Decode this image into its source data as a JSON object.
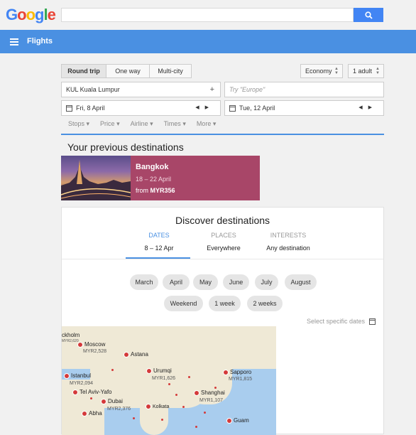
{
  "header": {
    "logo": "Google",
    "search_value": "",
    "section_title": "Flights"
  },
  "trip_type": {
    "options": [
      "Round trip",
      "One way",
      "Multi-city"
    ],
    "selected": "Round trip"
  },
  "cabin": "Economy",
  "passengers": "1 adult",
  "origin": "KUL Kuala Lumpur",
  "destination_placeholder": "Try \"Europe\"",
  "depart_date": "Fri, 8 April",
  "return_date": "Tue, 12 April",
  "filters": [
    "Stops",
    "Price",
    "Airline",
    "Times",
    "More"
  ],
  "previous": {
    "title": "Your previous destinations",
    "card": {
      "city": "Bangkok",
      "dates": "18 – 22 April",
      "price_prefix": "from",
      "price": "MYR356"
    }
  },
  "discover": {
    "title": "Discover destinations",
    "tabs": [
      {
        "label": "DATES",
        "value": "8 – 12 Apr"
      },
      {
        "label": "PLACES",
        "value": "Everywhere"
      },
      {
        "label": "INTERESTS",
        "value": "Any destination"
      }
    ],
    "active_tab": "DATES",
    "months": [
      "March",
      "April",
      "May",
      "June",
      "July",
      "August"
    ],
    "durations": [
      "Weekend",
      "1 week",
      "2 weeks"
    ],
    "select_dates": "Select specific dates"
  },
  "map": {
    "cities": [
      {
        "name": "ckholm",
        "price": "MYR2,620"
      },
      {
        "name": "Moscow",
        "price": "MYR2,528"
      },
      {
        "name": "Astana",
        "price": ""
      },
      {
        "name": "Istanbul",
        "price": "MYR2,094"
      },
      {
        "name": "Urumqi",
        "price": "MYR1,626"
      },
      {
        "name": "Sapporo",
        "price": "MYR1,815"
      },
      {
        "name": "Tel Aviv-Yafo",
        "price": ""
      },
      {
        "name": "Shanghai",
        "price": "MYR1,107"
      },
      {
        "name": "Dubai",
        "price": "MYR2,376"
      },
      {
        "name": "Abha",
        "price": ""
      },
      {
        "name": "Kolkata",
        "price": ""
      },
      {
        "name": "Guam",
        "price": ""
      }
    ]
  },
  "colors": {
    "brand_blue": "#4a90e2",
    "card": "#a84668"
  }
}
